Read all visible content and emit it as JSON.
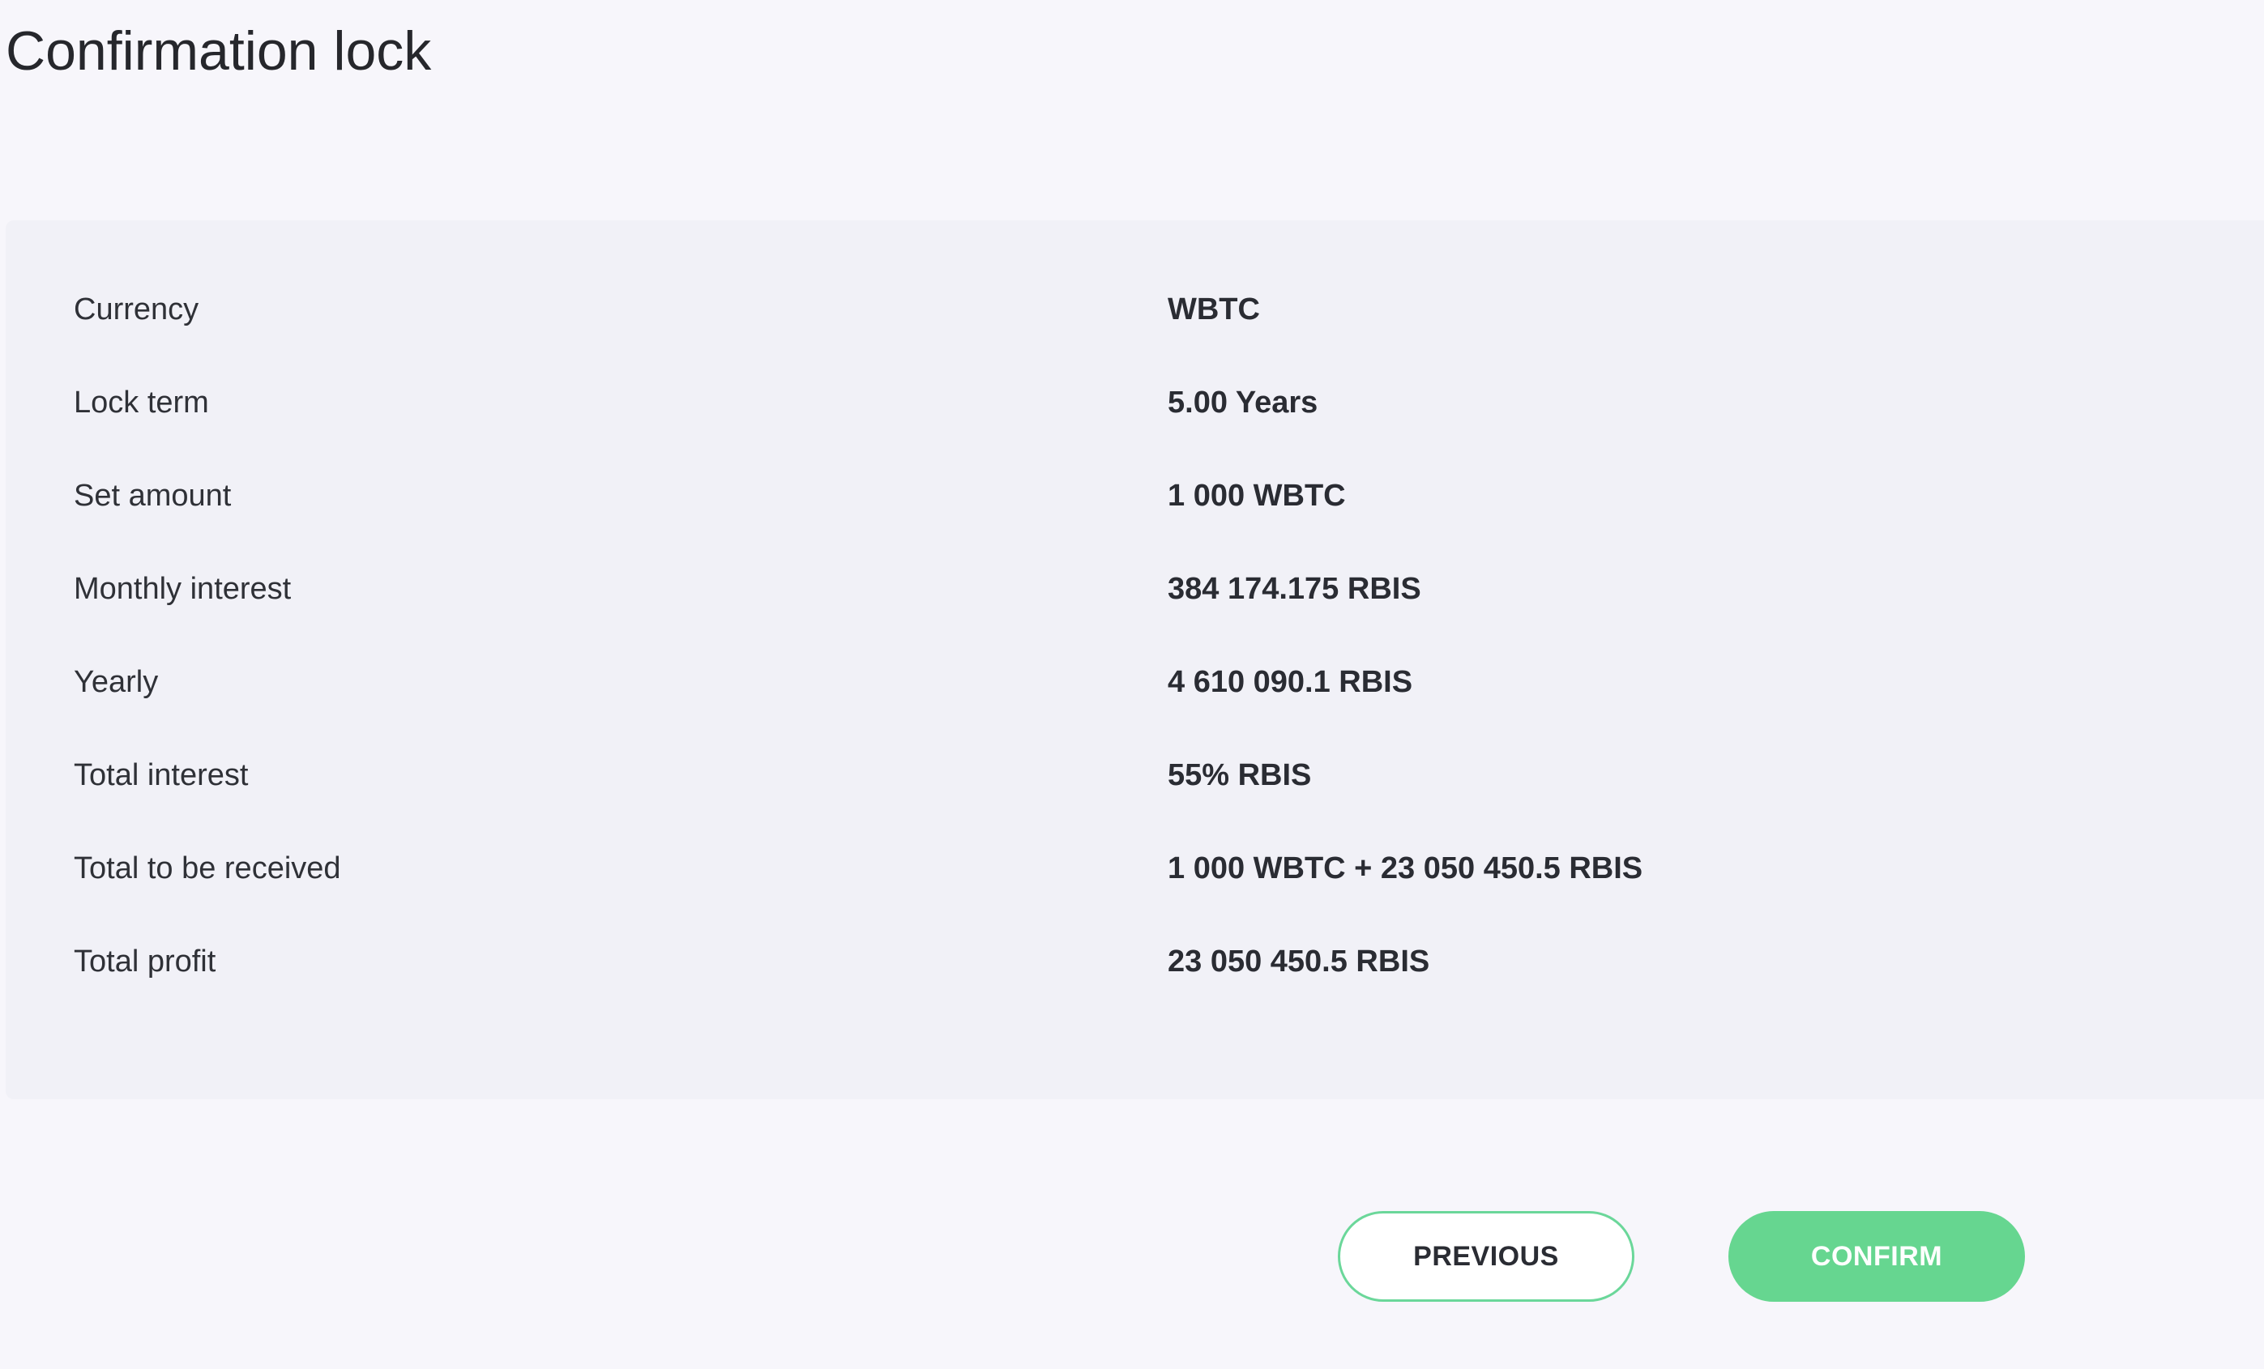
{
  "page": {
    "title": "Confirmation lock"
  },
  "summary": {
    "rows": [
      {
        "label": "Currency",
        "value": "WBTC"
      },
      {
        "label": "Lock term",
        "value": "5.00 Years"
      },
      {
        "label": "Set amount",
        "value": "1 000 WBTC"
      },
      {
        "label": "Monthly interest",
        "value": "384 174.175 RBIS"
      },
      {
        "label": "Yearly",
        "value": "4 610 090.1 RBIS"
      },
      {
        "label": "Total interest",
        "value": "55% RBIS"
      },
      {
        "label": "Total to be received",
        "value": "1 000 WBTC + 23 050 450.5 RBIS"
      },
      {
        "label": "Total profit",
        "value": "23 050 450.5 RBIS"
      }
    ]
  },
  "actions": {
    "previous_label": "PREVIOUS",
    "confirm_label": "CONFIRM"
  },
  "colors": {
    "background": "#f7f6fb",
    "panel": "#f1f1f7",
    "accent_green": "#66d690",
    "text_dark": "#2a2c33"
  }
}
